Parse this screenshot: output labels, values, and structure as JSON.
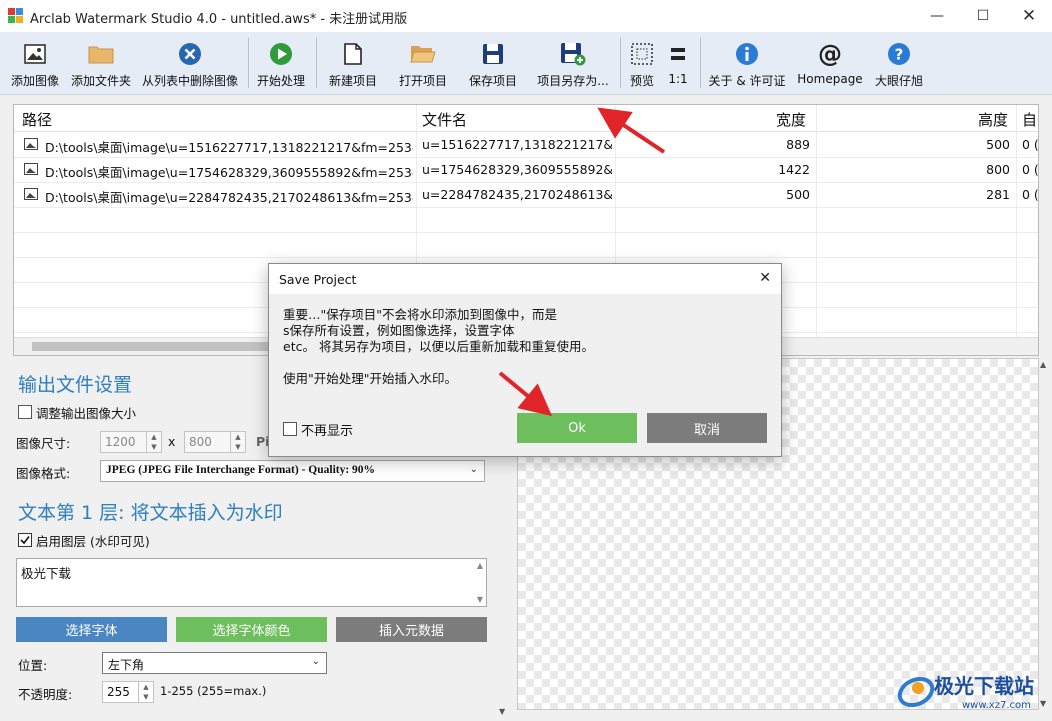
{
  "window": {
    "title": "Arclab Watermark Studio 4.0 - untitled.aws* - 未注册试用版",
    "controls": [
      "minimize",
      "maximize",
      "close"
    ]
  },
  "toolbar": {
    "buttons": [
      {
        "label": "添加图像",
        "icon": "image-icon"
      },
      {
        "label": "添加文件夹",
        "icon": "folder-icon"
      },
      {
        "label": "从列表中删除图像",
        "icon": "remove-icon"
      },
      {
        "label": "开始处理",
        "icon": "play-icon"
      },
      {
        "label": "新建项目",
        "icon": "new-file-icon"
      },
      {
        "label": "打开项目",
        "icon": "open-folder-icon"
      },
      {
        "label": "保存项目",
        "icon": "save-icon"
      },
      {
        "label": "项目另存为...",
        "icon": "save-as-icon"
      },
      {
        "label": "预览",
        "icon": "preview-icon"
      },
      {
        "label": "1:1",
        "icon": "equals-icon"
      },
      {
        "label": "关于 & 许可证",
        "icon": "info-icon"
      },
      {
        "label": "Homepage",
        "icon": "at-icon"
      },
      {
        "label": "大眼仔旭",
        "icon": "help-icon"
      }
    ]
  },
  "file_list": {
    "columns": [
      "路径",
      "文件名",
      "宽度",
      "高度",
      "自"
    ],
    "rows": [
      {
        "path": "D:\\tools\\桌面\\image\\u=1516227717,1318221217&fm=253&f...",
        "filename": "u=1516227717,1318221217&f...",
        "width": "889",
        "height": "500",
        "extra": "0 ("
      },
      {
        "path": "D:\\tools\\桌面\\image\\u=1754628329,3609555892&fm=253&f...",
        "filename": "u=1754628329,3609555892&f...",
        "width": "1422",
        "height": "800",
        "extra": "0 ("
      },
      {
        "path": "D:\\tools\\桌面\\image\\u=2284782435,2170248613&fm=253&f...",
        "filename": "u=2284782435,2170248613&f...",
        "width": "500",
        "height": "281",
        "extra": "0 ("
      }
    ]
  },
  "output": {
    "title": "输出文件设置",
    "resize_label": "调整输出图像大小",
    "size_label": "图像尺寸:",
    "width_value": "1200",
    "x": "x",
    "height_value": "800",
    "unit": "Pi",
    "format_label": "图像格式:",
    "format_value": "JPEG (JPEG File Interchange Format) - Quality: 90%"
  },
  "layer": {
    "title": "文本第 1 层: 将文本插入为水印",
    "enable_label": "启用图层 (水印可见)",
    "text_value": "极光下载",
    "btn_font": "选择字体",
    "btn_color": "选择字体颜色",
    "btn_meta": "插入元数据",
    "position_label": "位置:",
    "position_value": "左下角",
    "opacity_label": "不透明度:",
    "opacity_value": "255",
    "opacity_range": "1-255 (255=max.)"
  },
  "dialog": {
    "title": "Save Project",
    "line1": "重要…\"保存项目\"不会将水印添加到图像中，而是",
    "line2": "s保存所有设置，例如图像选择，设置字体",
    "line3": "etc。 将其另存为项目，以便以后重新加载和重复使用。",
    "line4": "使用\"开始处理\"开始插入水印。",
    "dont_show": "不再显示",
    "ok": "Ok",
    "cancel": "取消"
  },
  "watermark": {
    "text": "极光下载站",
    "sub": "www.xz7.com"
  },
  "colors": {
    "toolbar_bg": "#e6ecf5",
    "accent_blue": "#2e7fbf",
    "btn_blue": "#4a86c2",
    "btn_green": "#6cbf5c",
    "btn_gray": "#7c7c7c",
    "arrow_red": "#e0242a"
  }
}
